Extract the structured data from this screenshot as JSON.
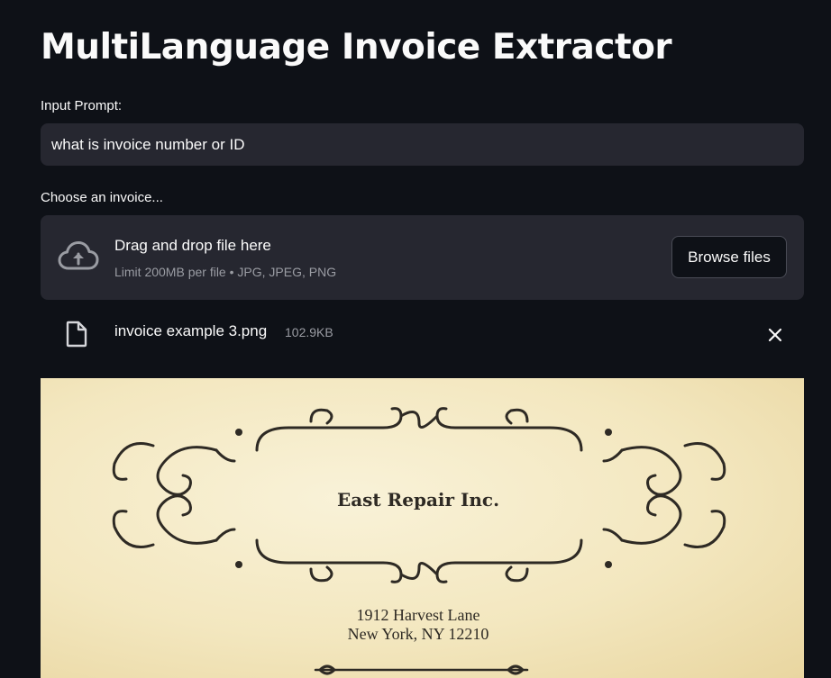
{
  "app": {
    "title": "MultiLanguage Invoice Extractor"
  },
  "prompt": {
    "label": "Input Prompt:",
    "value": "what is invoice number or ID"
  },
  "uploader": {
    "label": "Choose an invoice...",
    "dropzone_text": "Drag and drop file here",
    "limit_text": "Limit 200MB per file • JPG, JPEG, PNG",
    "browse_label": "Browse files",
    "icon": "cloud-upload-icon"
  },
  "uploaded_file": {
    "name": "invoice example 3.png",
    "size": "102.9KB",
    "icon": "file-icon",
    "remove_icon": "close-icon"
  },
  "invoice_preview": {
    "company_name": "East Repair Inc.",
    "address_line1": "1912 Harvest Lane",
    "address_line2": "New York, NY 12210"
  },
  "colors": {
    "background": "#0e1117",
    "surface": "#262730",
    "text": "#fafafa",
    "muted_text": "#9a9ca3",
    "paper": "#f3e7bf"
  }
}
